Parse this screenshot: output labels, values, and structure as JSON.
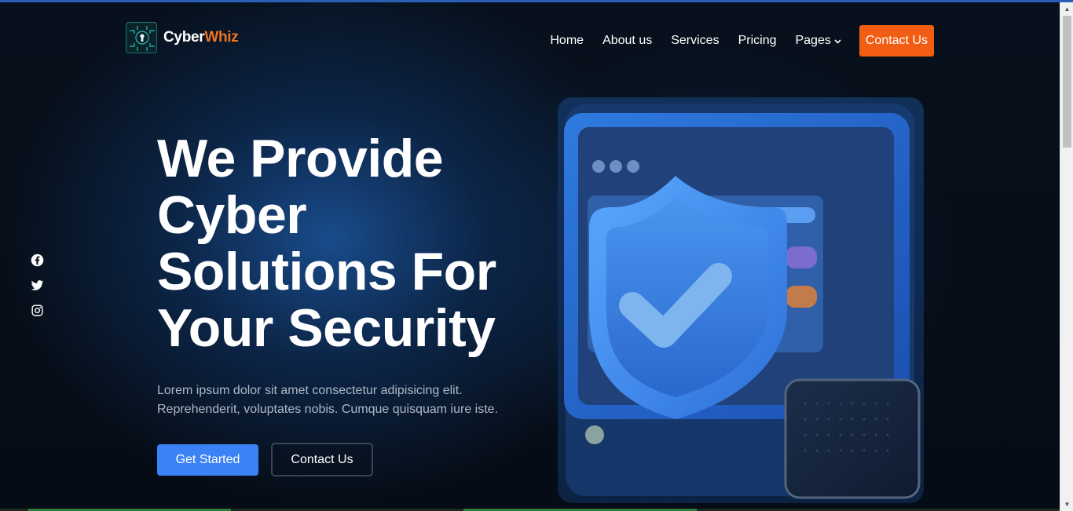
{
  "brand": {
    "name_part1": "Cyber",
    "name_part2": "Whiz",
    "logo_icon": "circuit-keyhole-icon"
  },
  "nav": {
    "items": [
      {
        "label": "Home"
      },
      {
        "label": "About us"
      },
      {
        "label": "Services"
      },
      {
        "label": "Pricing"
      },
      {
        "label": "Pages",
        "has_dropdown": true
      }
    ],
    "cta_label": "Contact Us"
  },
  "social": [
    "facebook-icon",
    "twitter-icon",
    "instagram-icon"
  ],
  "hero": {
    "title_lines": [
      "We Provide",
      "Cyber",
      "Solutions For",
      "Your Security"
    ],
    "description_lines": [
      "Lorem ipsum dolor sit amet consectetur adipisicing elit.",
      "Reprehenderit, voluptates nobis. Cumque quisquam iure iste."
    ],
    "primary_button": "Get Started",
    "secondary_button": "Contact Us",
    "illustration": "shield-checkmark-browser-illustration"
  },
  "colors": {
    "accent_orange": "#f25d14",
    "brand_orange": "#f0741e",
    "primary_blue": "#3b82f6",
    "background": "#060b12"
  }
}
